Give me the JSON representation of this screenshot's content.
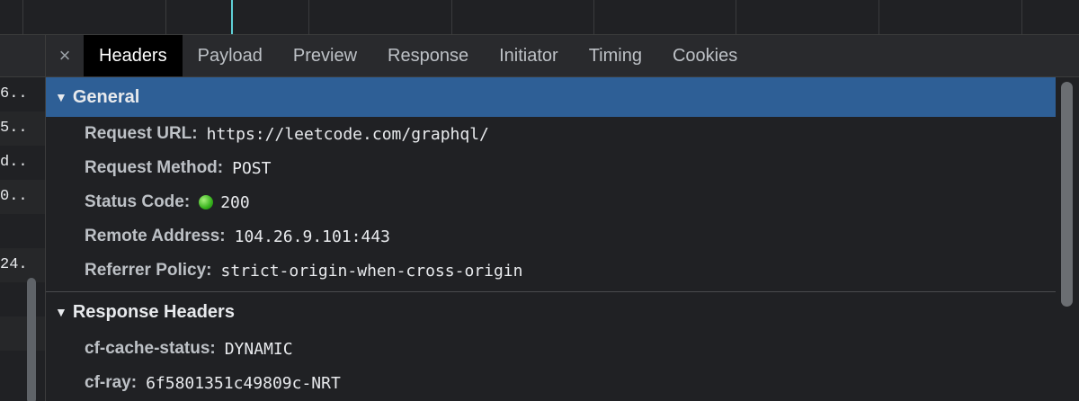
{
  "left_list": {
    "rows": [
      "6..",
      "5..",
      "d..",
      "0..",
      "",
      "24.",
      "",
      ""
    ]
  },
  "tabs": [
    {
      "label": "Headers",
      "active": true
    },
    {
      "label": "Payload",
      "active": false
    },
    {
      "label": "Preview",
      "active": false
    },
    {
      "label": "Response",
      "active": false
    },
    {
      "label": "Initiator",
      "active": false
    },
    {
      "label": "Timing",
      "active": false
    },
    {
      "label": "Cookies",
      "active": false
    }
  ],
  "close_glyph": "×",
  "general": {
    "title": "General",
    "rows": [
      {
        "key": "Request URL:",
        "value": "https://leetcode.com/graphql/"
      },
      {
        "key": "Request Method:",
        "value": "POST"
      },
      {
        "key": "Status Code:",
        "value": "200"
      },
      {
        "key": "Remote Address:",
        "value": "104.26.9.101:443"
      },
      {
        "key": "Referrer Policy:",
        "value": "strict-origin-when-cross-origin"
      }
    ]
  },
  "response_headers": {
    "title": "Response Headers",
    "rows": [
      {
        "key": "cf-cache-status:",
        "value": "DYNAMIC"
      },
      {
        "key": "cf-ray:",
        "value": "6f5801351c49809c-NRT"
      }
    ]
  },
  "colors": {
    "selected_section": "#2e5f96",
    "status_ok": "#36b11c",
    "timeline_marker": "#5fd0d6"
  }
}
